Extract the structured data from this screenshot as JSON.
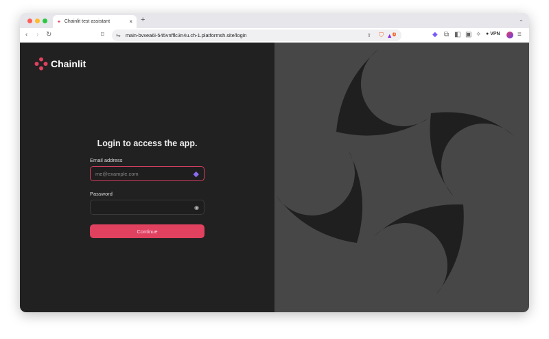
{
  "browser": {
    "tab_title": "Chainlit test assistant",
    "url": "main-bvxea6i-545vnfflc3n4u.ch-1.platformsh.site/login",
    "vpn_label": "VPN",
    "notification_count": "1"
  },
  "app": {
    "logo_text": "Chainlit",
    "brand_color": "#e0415f"
  },
  "login": {
    "title": "Login to access the app.",
    "email_label": "Email address",
    "email_placeholder": "me@example.com",
    "email_value": "",
    "password_label": "Password",
    "continue_label": "Continue"
  }
}
